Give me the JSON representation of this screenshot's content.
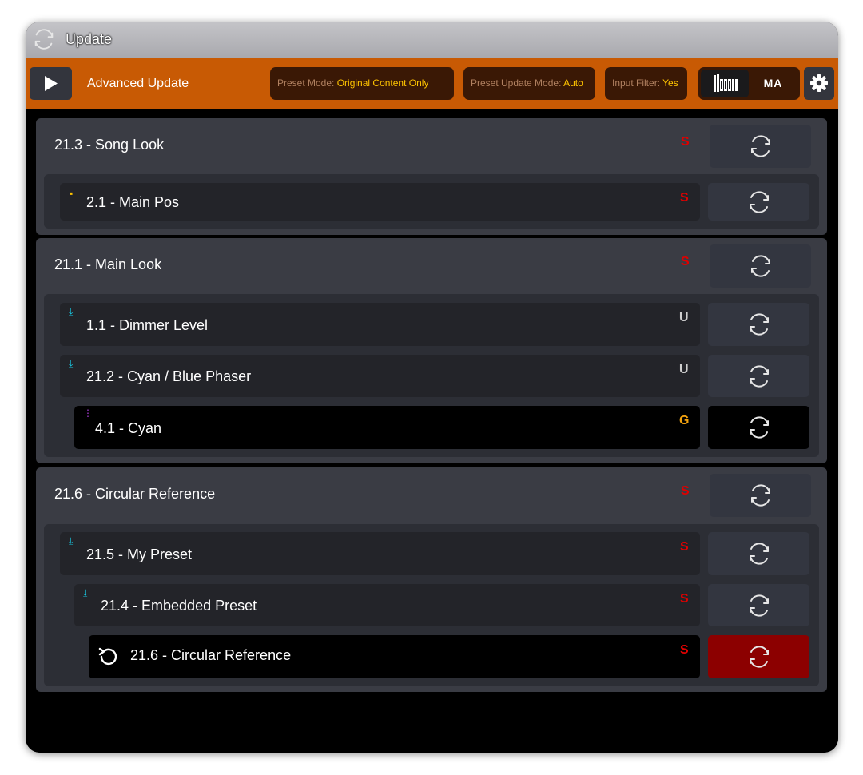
{
  "window": {
    "title": "Update",
    "title_icon": "refresh-icon"
  },
  "toolbar": {
    "title": "Advanced Update",
    "play_icon": "play-icon",
    "preset_mode": {
      "label": "Preset Mode:",
      "value": "Original Content Only"
    },
    "preset_update_mode": {
      "label": "Preset Update Mode:",
      "value": "Auto"
    },
    "input_filter": {
      "label": "Input Filter:",
      "value": "Yes"
    },
    "toggle": {
      "options": [
        "GrandMA Tools logo",
        "MA"
      ],
      "selected": "GrandMA Tools logo",
      "ma_label": "MA"
    },
    "settings_icon": "gear-icon"
  },
  "groups": [
    {
      "title": "21.3 - Song Look",
      "flag": "S",
      "items": [
        {
          "title": "2.1 - Main Pos",
          "flag": "S",
          "marker": "yellow-square"
        }
      ]
    },
    {
      "title": "21.1 - Main Look",
      "flag": "S",
      "items": [
        {
          "title": "1.1 - Dimmer Level",
          "flag": "U",
          "marker": "download-arrow"
        },
        {
          "title": "21.2 - Cyan / Blue Phaser",
          "flag": "U",
          "marker": "download-arrow"
        },
        {
          "title": "4.1 - Cyan",
          "flag": "G",
          "marker": "purple-dots"
        }
      ]
    },
    {
      "title": "21.6 - Circular Reference",
      "flag": "S",
      "items": [
        {
          "title": "21.5 - My Preset",
          "flag": "S",
          "marker": "download-arrow"
        },
        {
          "title": "21.4 - Embedded Preset",
          "flag": "S",
          "marker": "download-arrow"
        },
        {
          "title": "21.6 - Circular Reference",
          "flag": "S",
          "marker": "circular-reference-icon"
        }
      ]
    }
  ],
  "colors": {
    "accent_orange": "#c85a04",
    "flag_S": "#e00000",
    "flag_U": "#cfcfcf",
    "flag_G": "#f2a20e",
    "circular_update_button": "#8c0000",
    "chip_value": "#ffc400"
  }
}
